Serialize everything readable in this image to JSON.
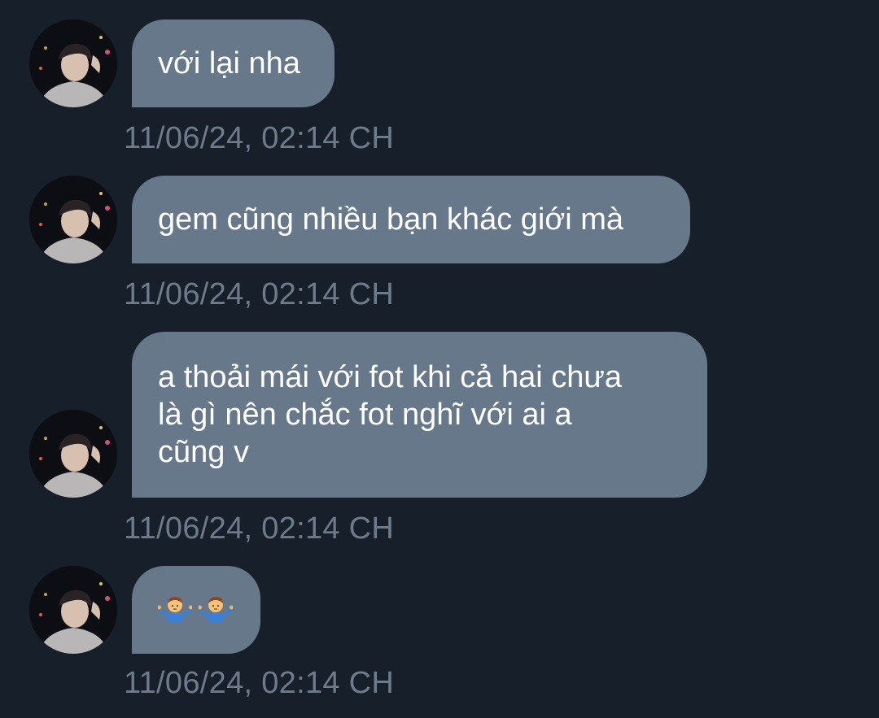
{
  "messages": [
    {
      "text": "với lại nha",
      "time": "11/06/24, 02:14 CH"
    },
    {
      "text": "gem cũng nhiều bạn khác giới mà",
      "time": "11/06/24, 02:14 CH"
    },
    {
      "text": "a thoải mái với fot khi cả hai chưa\nlà gì nên chắc fot nghĩ với ai a\ncũng v",
      "time": "11/06/24, 02:14 CH"
    },
    {
      "emoji": [
        "person-shrugging-icon",
        "person-shrugging-icon"
      ],
      "time": "11/06/24, 02:14 CH"
    }
  ],
  "colors": {
    "background": "#171f2a",
    "bubble": "#66788a",
    "timestamp": "#6e7b8a"
  }
}
